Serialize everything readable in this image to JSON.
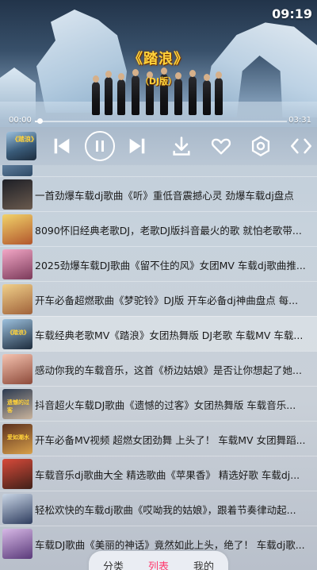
{
  "status": {
    "time": "09:19"
  },
  "player": {
    "title": "《踏浪》",
    "subtitle": "（DJ版）",
    "current_time": "00:00",
    "total_time": "03:31",
    "progress": 0.02,
    "thumb_tag": "《踏浪》"
  },
  "controls": {
    "icons": [
      "skip-previous-icon",
      "pause-icon",
      "skip-next-icon",
      "download-icon",
      "heart-icon",
      "settings-icon",
      "fullscreen-icon"
    ]
  },
  "list": [
    {
      "title": "一首劲爆车载dj歌曲《听》重低音震撼心灵 劲爆车载dj盘点",
      "tag": ""
    },
    {
      "title": "8090怀旧经典老歌DJ，老歌DJ版抖音最火的歌 就怕老歌带...",
      "tag": ""
    },
    {
      "title": "2025劲爆车载DJ歌曲《留不住的风》女团MV 车载dj歌曲推...",
      "tag": ""
    },
    {
      "title": "开车必备超燃歌曲《梦驼铃》DJ版 开车必备dj神曲盘点 每...",
      "tag": ""
    },
    {
      "title": "车载经典老歌MV《踏浪》女团热舞版 DJ老歌 车载MV 车载...",
      "tag": "《踏浪》",
      "active": true
    },
    {
      "title": "感动你我的车载音乐，这首《桥边姑娘》是否让你想起了她...",
      "tag": ""
    },
    {
      "title": "抖音超火车载DJ歌曲《遗憾的过客》女团热舞版 车载音乐...",
      "tag": "遗憾的过客"
    },
    {
      "title": "开车必备MV视频 超燃女团劲舞 上头了！ 车载MV 女团舞蹈...",
      "tag": "爱如潮水"
    },
    {
      "title": "车载音乐dj歌曲大全 精选歌曲《苹果香》 精选好歌 车载dj...",
      "tag": ""
    },
    {
      "title": "轻松欢快的车载dj歌曲《哎呦我的姑娘》，跟着节奏律动起...",
      "tag": ""
    },
    {
      "title": "车载DJ歌曲《美丽的神话》竟然如此上头，绝了！ 车载dj歌...",
      "tag": ""
    }
  ],
  "thumb_colors": [
    [
      "#1d1f26",
      "#6a5a4e"
    ],
    [
      "#f1d36a",
      "#b2562c"
    ],
    [
      "#f3a7c6",
      "#7b3a5a"
    ],
    [
      "#f0d08a",
      "#a0623a"
    ],
    [
      "#9cc0dd",
      "#1d2c3d"
    ],
    [
      "#f5c3b0",
      "#8d4a3a"
    ],
    [
      "#2b3a50",
      "#c9b39c"
    ],
    [
      "#5a2f1e",
      "#d8a04a"
    ],
    [
      "#d84a3a",
      "#402018"
    ],
    [
      "#c9d6e6",
      "#2e3c5e"
    ],
    [
      "#d7b8e6",
      "#5a3a7a"
    ]
  ],
  "tabs": [
    {
      "label": "分类",
      "active": false
    },
    {
      "label": "列表",
      "active": true
    },
    {
      "label": "我的",
      "active": false
    }
  ]
}
